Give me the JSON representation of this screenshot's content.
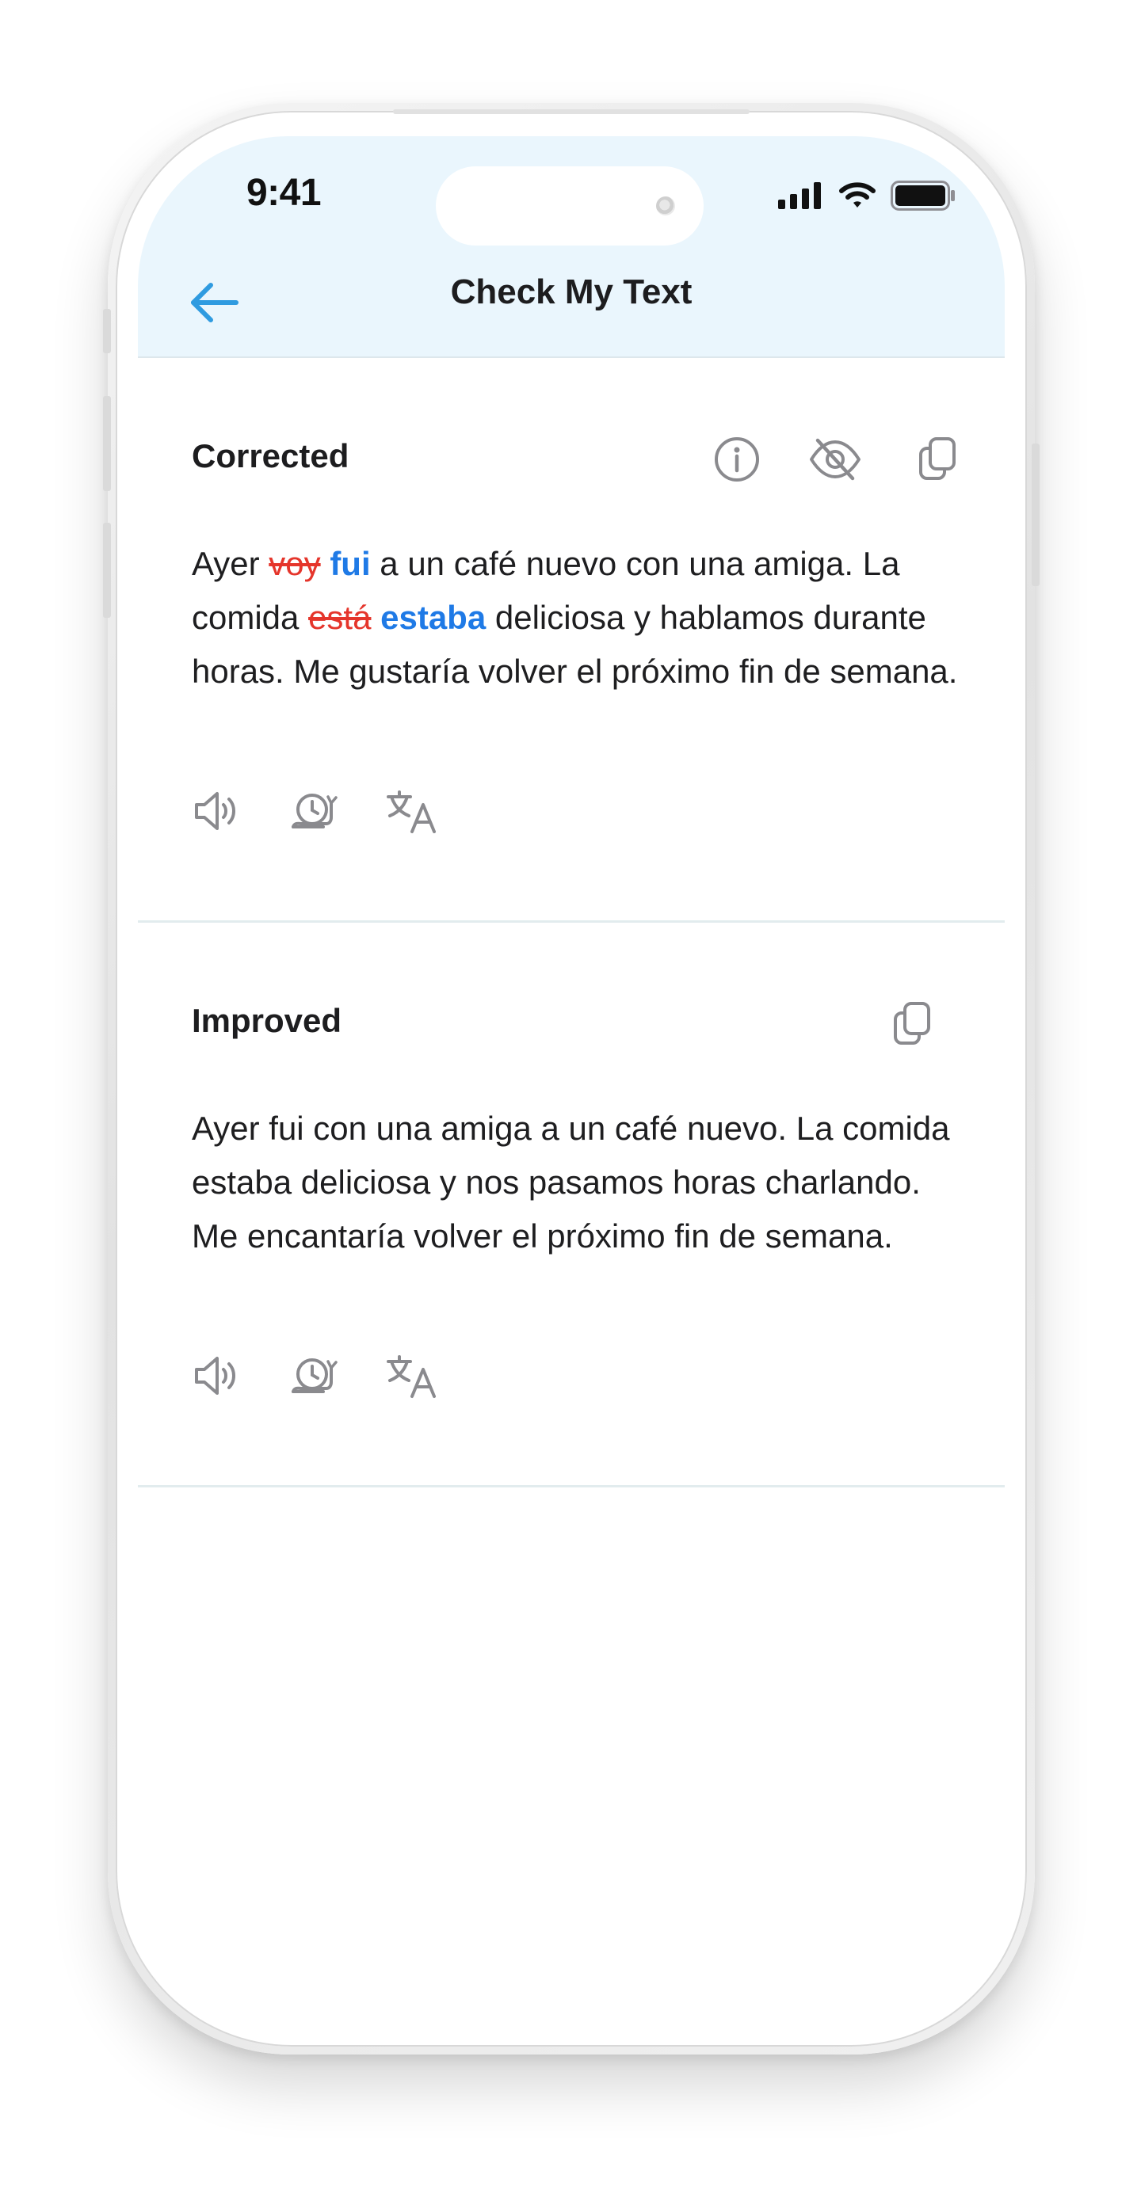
{
  "status_bar": {
    "time": "9:41"
  },
  "header": {
    "title": "Check My Text"
  },
  "corrected": {
    "title": "Corrected",
    "segments": {
      "s1": "Ayer ",
      "del1": "voy",
      "ins1": "fui",
      "s2": " a un café nuevo con una amiga. La comida ",
      "del2": "está",
      "ins2": "estaba",
      "s3": " deliciosa y hablamos durante horas. Me gustaría volver el próximo fin de semana."
    }
  },
  "improved": {
    "title": "Improved",
    "text": "Ayer fui con una amiga a un café nuevo. La comida estaba deliciosa y nos pasamos horas charlando. Me encantaría volver el próximo fin de semana."
  },
  "colors": {
    "accent": "#2f9be0",
    "header_bg": "#eaf6fd",
    "deletion": "#e5352b",
    "insertion": "#1f7ae6",
    "icon_gray": "#8a8a8e"
  },
  "icons": [
    "back-arrow-icon",
    "info-icon",
    "eye-off-icon",
    "copy-icon",
    "speaker-icon",
    "slow-snail-icon",
    "translate-icon"
  ]
}
